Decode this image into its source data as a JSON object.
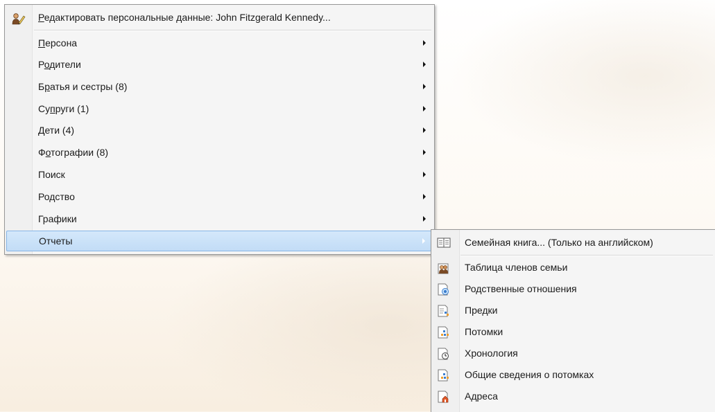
{
  "main_menu": {
    "header_item": {
      "mnemonic": "Р",
      "rest": "едактировать персональные данные: John Fitzgerald Kennedy...",
      "icon": "person-edit-icon"
    },
    "items": [
      {
        "pre": "",
        "mnemonic": "П",
        "post": "ерсона",
        "has_submenu": true
      },
      {
        "pre": "Р",
        "mnemonic": "о",
        "post": "дители",
        "has_submenu": true
      },
      {
        "pre": "Б",
        "mnemonic": "р",
        "post": "атья и сестры (8)",
        "has_submenu": true
      },
      {
        "pre": "Су",
        "mnemonic": "п",
        "post": "руги (1)",
        "has_submenu": true
      },
      {
        "pre": "",
        "mnemonic": "Д",
        "post": "ети (4)",
        "has_submenu": true
      },
      {
        "pre": "Ф",
        "mnemonic": "о",
        "post": "тографии (8)",
        "has_submenu": true
      },
      {
        "pre": "Поиск",
        "mnemonic": "",
        "post": "",
        "has_submenu": true
      },
      {
        "pre": "Родство",
        "mnemonic": "",
        "post": "",
        "has_submenu": true
      },
      {
        "pre": "Графики",
        "mnemonic": "",
        "post": "",
        "has_submenu": true
      },
      {
        "pre": "Отчеты",
        "mnemonic": "",
        "post": "",
        "has_submenu": true,
        "active": true
      }
    ]
  },
  "sub_menu": {
    "items": [
      {
        "label": "Семейная книга... (Только на английском)",
        "icon": "book-icon"
      },
      {
        "label": "Таблица членов семьи",
        "icon": "family-members-icon"
      },
      {
        "label": "Родственные отношения",
        "icon": "relationship-icon"
      },
      {
        "label": "Предки",
        "icon": "ancestors-icon"
      },
      {
        "label": "Потомки",
        "icon": "descendants-icon"
      },
      {
        "label": "Хронология",
        "icon": "timeline-icon"
      },
      {
        "label": "Общие сведения о потомках",
        "icon": "descendants-summary-icon"
      },
      {
        "label": "Адреса",
        "icon": "addresses-icon"
      }
    ]
  },
  "colors": {
    "highlight": "#c8e0f8",
    "highlight_border": "#86b5e6",
    "menu_bg": "#f5f5f5"
  }
}
